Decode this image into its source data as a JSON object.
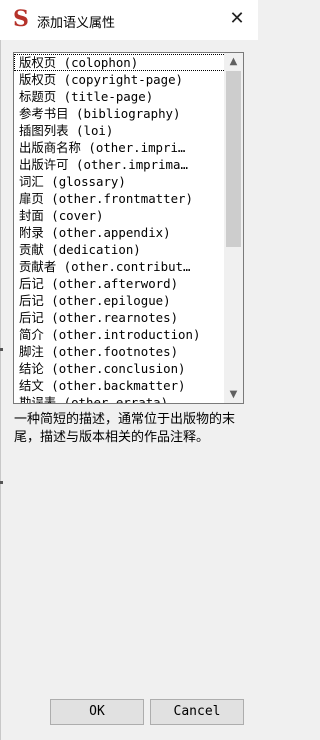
{
  "window": {
    "title": "添加语义属性",
    "icon": "s-app-icon",
    "close_glyph": "✕",
    "app_icon_glyph": "S"
  },
  "list": {
    "items": [
      "版权页 (colophon)",
      "版权页 (copyright-page)",
      "标题页 (title-page)",
      "参考书目 (bibliography)",
      "插图列表 (loi)",
      "出版商名称 (other.impri…",
      "出版许可 (other.imprima…",
      "词汇 (glossary)",
      "扉页 (other.frontmatter)",
      "封面 (cover)",
      "附录 (other.appendix)",
      "贡献 (dedication)",
      "贡献者 (other.contribut…",
      "后记 (other.afterword)",
      "后记 (other.epilogue)",
      "后记 (other.rearnotes)",
      "简介 (other.introduction)",
      "脚注 (other.footnotes)",
      "结论 (other.conclusion)",
      "结文 (other.backmatter)",
      "勘误表 (other.errata)"
    ],
    "scroll_up_glyph": "▲",
    "scroll_down_glyph": "▼"
  },
  "description": "一种简短的描述，通常位于出版物的末尾，描述与版本相关的作品注释。",
  "buttons": {
    "ok": "OK",
    "cancel": "Cancel"
  }
}
